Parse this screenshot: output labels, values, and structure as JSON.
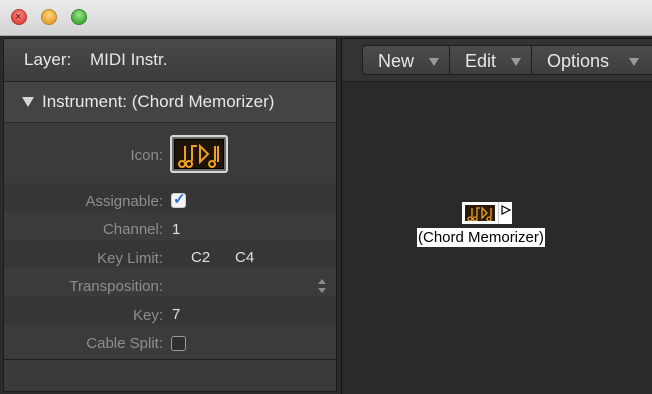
{
  "window": {
    "traffic_lights": [
      "close",
      "minimize",
      "zoom"
    ],
    "close_glyph": "×"
  },
  "inspector": {
    "layer_label": "Layer:",
    "layer_value": "MIDI Instr.",
    "instrument_header": "Instrument: (Chord Memorizer)",
    "properties": {
      "icon_label": "Icon:",
      "assignable_label": "Assignable:",
      "assignable_checked": true,
      "channel_label": "Channel:",
      "channel_value": "1",
      "key_limit_label": "Key Limit:",
      "key_limit_low": "C2",
      "key_limit_high": "C4",
      "transposition_label": "Transposition:",
      "transposition_value": "",
      "key_label": "Key:",
      "key_value": "7",
      "cable_split_label": "Cable Split:",
      "cable_split_checked": false
    }
  },
  "toolbar": {
    "new_label": "New",
    "edit_label": "Edit",
    "options_label": "Options"
  },
  "canvas": {
    "object_label": "(Chord Memorizer)"
  },
  "colors": {
    "icon_glyph": "#f0a020",
    "checkmark": "#2a6fd6"
  }
}
